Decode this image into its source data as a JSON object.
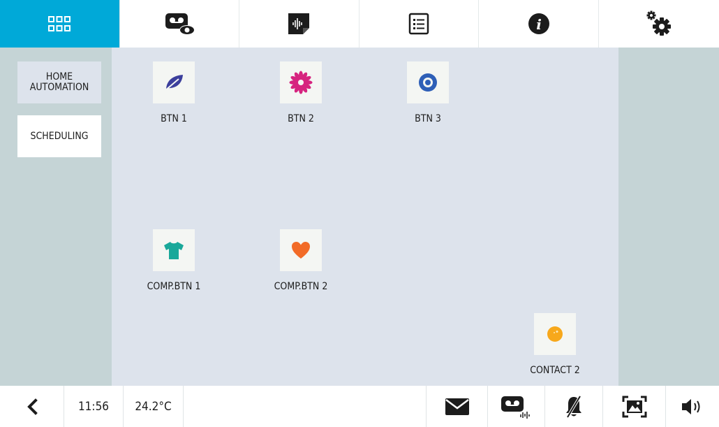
{
  "topbar": {
    "tabs": [
      {
        "icon": "grid-icon",
        "active": true
      },
      {
        "icon": "voicemail-view-icon",
        "active": false
      },
      {
        "icon": "audio-memo-icon",
        "active": false
      },
      {
        "icon": "list-icon",
        "active": false
      },
      {
        "icon": "info-icon",
        "active": false
      },
      {
        "icon": "settings-icon",
        "active": false
      }
    ]
  },
  "sidebar": {
    "items": [
      {
        "label_line1": "HOME",
        "label_line2": "AUTOMATION",
        "active": true
      },
      {
        "label": "SCHEDULING",
        "active": false
      }
    ]
  },
  "main": {
    "buttons": [
      {
        "label": "BTN 1",
        "icon": "leaf-icon",
        "color": "#3c3f9c"
      },
      {
        "label": "BTN 2",
        "icon": "flower-icon",
        "color": "#d6247f"
      },
      {
        "label": "BTN 3",
        "icon": "target-icon",
        "color": "#2e5fb7"
      },
      {
        "label": "COMP.BTN 1",
        "icon": "shirt-icon",
        "color": "#1aa89a"
      },
      {
        "label": "COMP.BTN 2",
        "icon": "heart-icon",
        "color": "#f26b27"
      },
      {
        "label": "CONTACT 2",
        "icon": "contact-icon",
        "color": "#f7a81b"
      }
    ]
  },
  "bottombar": {
    "back_icon": "chevron-left-icon",
    "time": "11:56",
    "temperature": "24.2°C",
    "icons": [
      "mail-icon",
      "voicemail-audio-icon",
      "bell-muted-icon",
      "image-frame-icon",
      "volume-icon"
    ]
  },
  "colors": {
    "accent": "#00a9d8",
    "panel": "#c5d4d6",
    "main": "#dde3ec",
    "tile": "#f4f6f3"
  }
}
